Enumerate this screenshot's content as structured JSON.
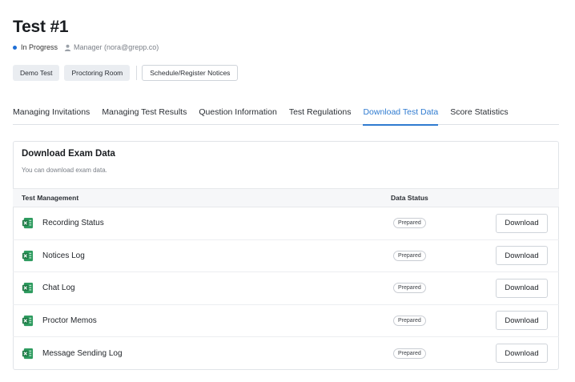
{
  "header": {
    "title": "Test #1",
    "status": "In Progress",
    "manager": "Manager (nora@grepp.co)"
  },
  "actions": {
    "demo_test": "Demo Test",
    "proctoring_room": "Proctoring Room",
    "schedule_notices": "Schedule/Register Notices"
  },
  "tabs": [
    {
      "label": "Managing Invitations"
    },
    {
      "label": "Managing Test Results"
    },
    {
      "label": "Question Information"
    },
    {
      "label": "Test Regulations"
    },
    {
      "label": "Download Test Data",
      "active": true
    },
    {
      "label": "Score Statistics"
    }
  ],
  "card": {
    "title": "Download Exam Data",
    "subtitle": "You can download exam data.",
    "columns": {
      "name": "Test Management",
      "status": "Data Status"
    },
    "rows": [
      {
        "label": "Recording Status",
        "status": "Prepared",
        "action": "Download"
      },
      {
        "label": "Notices Log",
        "status": "Prepared",
        "action": "Download"
      },
      {
        "label": "Chat Log",
        "status": "Prepared",
        "action": "Download"
      },
      {
        "label": "Proctor Memos",
        "status": "Prepared",
        "action": "Download"
      },
      {
        "label": "Message Sending Log",
        "status": "Prepared",
        "action": "Download"
      }
    ]
  },
  "colors": {
    "accent": "#2f7bd0",
    "status_dot": "#1f6fd6",
    "excel_green": "#1d7a45"
  },
  "icons": {
    "manager": "person-icon",
    "file": "excel-file-icon"
  }
}
